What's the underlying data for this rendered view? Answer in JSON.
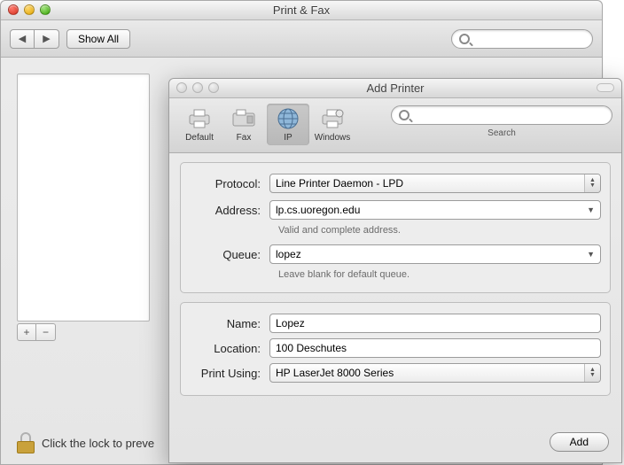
{
  "bg": {
    "title": "Print & Fax",
    "show_all_label": "Show All",
    "search_placeholder": "",
    "add_plus": "+",
    "remove_minus": "−",
    "lock_text": "Click the lock to preve"
  },
  "fg": {
    "title": "Add Printer",
    "toolbar": {
      "items": [
        {
          "label": "Default"
        },
        {
          "label": "Fax"
        },
        {
          "label": "IP"
        },
        {
          "label": "Windows"
        }
      ],
      "search_label": "Search",
      "search_placeholder": ""
    },
    "section1": {
      "protocol_label": "Protocol:",
      "protocol_value": "Line Printer Daemon - LPD",
      "address_label": "Address:",
      "address_value": "lp.cs.uoregon.edu",
      "address_hint": "Valid and complete address.",
      "queue_label": "Queue:",
      "queue_value": "lopez",
      "queue_hint": "Leave blank for default queue."
    },
    "section2": {
      "name_label": "Name:",
      "name_value": "Lopez",
      "location_label": "Location:",
      "location_value": "100 Deschutes",
      "printusing_label": "Print Using:",
      "printusing_value": "HP LaserJet 8000 Series"
    },
    "add_label": "Add"
  }
}
